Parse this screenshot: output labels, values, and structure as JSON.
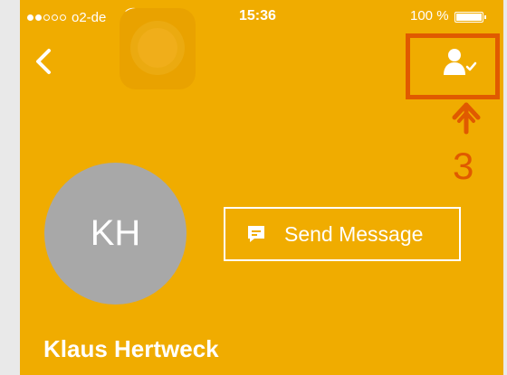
{
  "status_bar": {
    "carrier": "o2-de",
    "time": "15:36",
    "battery": "100 %",
    "icons": [
      "signal-dots-icon",
      "wifi-icon",
      "battery-icon"
    ]
  },
  "nav": {
    "back_icon": "chevron-left-icon",
    "contact_icon": "contact-verified-icon"
  },
  "annotation": {
    "step": "3",
    "color": "#e05a00"
  },
  "contact": {
    "initials": "KH",
    "name": "Klaus Hertweck"
  },
  "actions": {
    "send_message_label": "Send Message",
    "send_message_icon": "message-bubble-icon"
  },
  "colors": {
    "background": "#f0ac00",
    "avatar": "#a8a8a8",
    "text": "#ffffff"
  }
}
